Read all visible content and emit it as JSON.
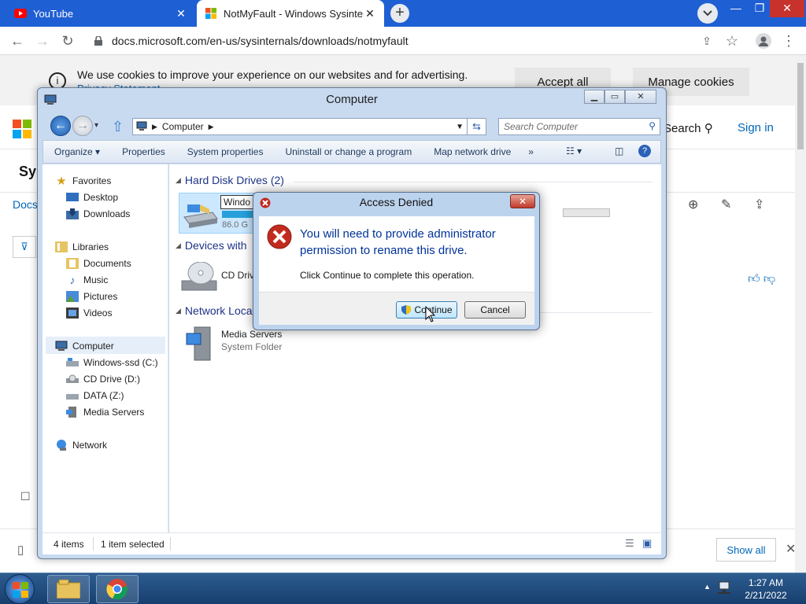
{
  "browser": {
    "tabs": [
      {
        "title": "YouTube",
        "icon": "youtube-icon",
        "active": false
      },
      {
        "title": "NotMyFault - Windows Sysinternals",
        "icon": "microsoft-icon",
        "active": true
      }
    ],
    "url": "docs.microsoft.com/en-us/sysinternals/downloads/notmyfault"
  },
  "page": {
    "cookie_msg": "We use cookies to improve your experience on our websites and for advertising.",
    "privacy_link": "Privacy Statement",
    "accept_all": "Accept all",
    "manage_cookies": "Manage cookies",
    "search_label": "Search",
    "sign_in": "Sign in",
    "partial_sys": "Sys",
    "partial_docs": "Docs",
    "show_all": "Show all"
  },
  "explorer": {
    "title": "Computer",
    "address": "Computer",
    "search_placeholder": "Search Computer",
    "commands": [
      "Organize ▾",
      "Properties",
      "System properties",
      "Uninstall or change a program",
      "Map network drive",
      "»"
    ],
    "nav": {
      "favorites": "Favorites",
      "desktop": "Desktop",
      "downloads": "Downloads",
      "libraries": "Libraries",
      "documents": "Documents",
      "music": "Music",
      "pictures": "Pictures",
      "videos": "Videos",
      "computer": "Computer",
      "windows_ssd": "Windows-ssd (C:)",
      "cd_drive": "CD Drive (D:)",
      "data": "DATA (Z:)",
      "media_servers": "Media Servers",
      "network": "Network"
    },
    "groups": {
      "hdd": "Hard Disk Drives (2)",
      "removable": "Devices with",
      "network": "Network Loca"
    },
    "items": {
      "drive_c_rename": "Windo",
      "drive_c_free": "86.0 G",
      "cd_drive": "CD Driv",
      "media_servers": "Media Servers",
      "media_servers_type": "System Folder"
    },
    "status": {
      "count": "4 items",
      "selected": "1 item selected"
    }
  },
  "dialog": {
    "title": "Access Denied",
    "main": "You will need to provide administrator permission to rename this drive.",
    "sub": "Click Continue to complete this operation.",
    "continue": "Continue",
    "cancel": "Cancel"
  },
  "taskbar": {
    "time": "1:27 AM",
    "date": "2/21/2022"
  }
}
